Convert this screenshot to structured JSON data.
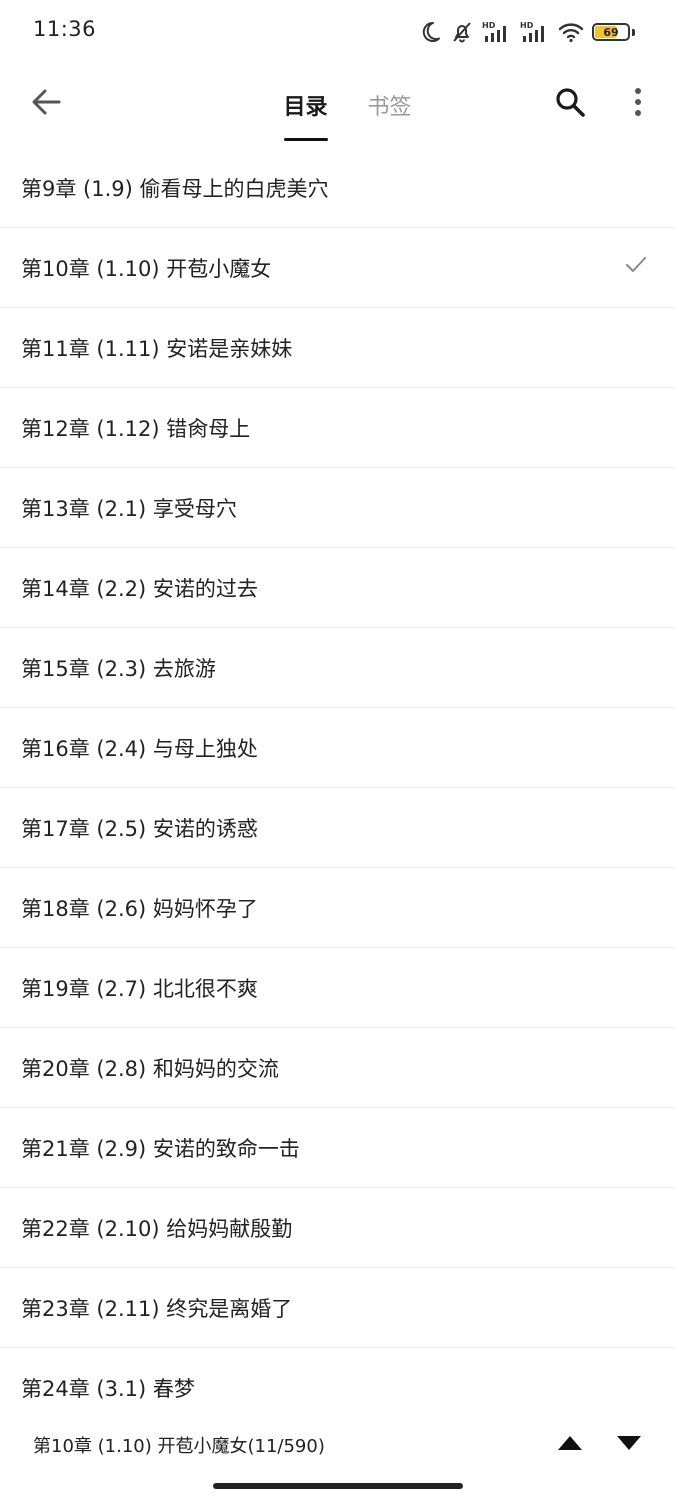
{
  "status_bar": {
    "time": "11:36",
    "battery_level": 69,
    "battery_text": "69",
    "battery_color": "#f2c230",
    "icons": [
      "moon-icon",
      "bell-off-icon",
      "hd-signal-icon",
      "hd-signal-icon",
      "wifi-icon",
      "battery-icon"
    ],
    "hd_label": "HD"
  },
  "app_bar": {
    "tabs": [
      {
        "label": "目录",
        "active": true
      },
      {
        "label": "书签",
        "active": false
      }
    ],
    "icons": [
      "back-arrow-icon",
      "search-icon",
      "more-vertical-icon"
    ]
  },
  "chapters": [
    {
      "title": "第9章 (1.9) 偷看母上的白虎美穴",
      "current": false
    },
    {
      "title": "第10章 (1.10) 开苞小魔女",
      "current": true
    },
    {
      "title": "第11章 (1.11) 安诺是亲妹妹",
      "current": false
    },
    {
      "title": "第12章 (1.12) 错肏母上",
      "current": false
    },
    {
      "title": "第13章 (2.1) 享受母穴",
      "current": false
    },
    {
      "title": "第14章 (2.2) 安诺的过去",
      "current": false
    },
    {
      "title": "第15章 (2.3) 去旅游",
      "current": false
    },
    {
      "title": "第16章 (2.4) 与母上独处",
      "current": false
    },
    {
      "title": "第17章 (2.5) 安诺的诱惑",
      "current": false
    },
    {
      "title": "第18章 (2.6) 妈妈怀孕了",
      "current": false
    },
    {
      "title": "第19章 (2.7) 北北很不爽",
      "current": false
    },
    {
      "title": "第20章 (2.8) 和妈妈的交流",
      "current": false
    },
    {
      "title": "第21章 (2.9) 安诺的致命一击",
      "current": false
    },
    {
      "title": "第22章 (2.10) 给妈妈献殷勤",
      "current": false
    },
    {
      "title": "第23章 (2.11) 终究是离婚了",
      "current": false
    },
    {
      "title": "第24章 (3.1) 春梦",
      "current": false
    }
  ],
  "bottom_bar": {
    "current_chapter": "第10章 (1.10) 开苞小魔女(11/590)",
    "icons": [
      "triangle-up-icon",
      "triangle-down-icon"
    ]
  }
}
